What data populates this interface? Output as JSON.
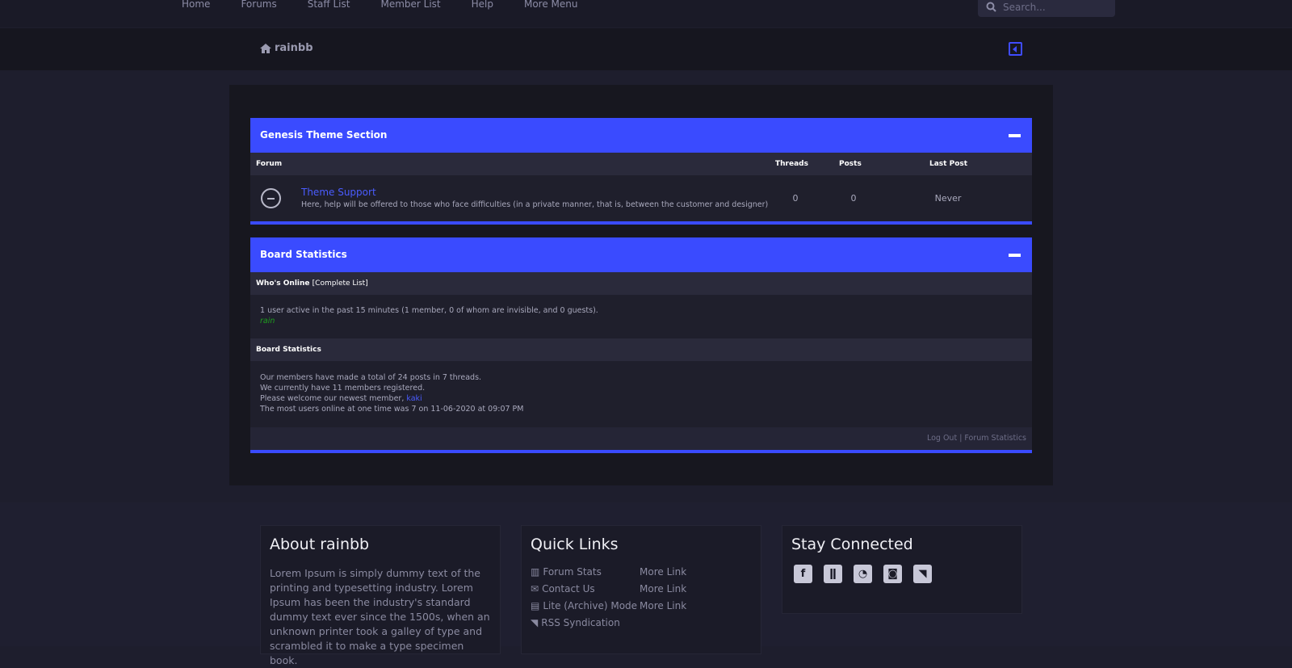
{
  "nav": {
    "items": [
      "Home",
      "Forums",
      "Staff List",
      "Member List",
      "Help",
      "More Menu"
    ],
    "search_placeholder": "Search..."
  },
  "breadcrumb": {
    "home": "rainbb"
  },
  "section1": {
    "title": "Genesis Theme Section",
    "columns": {
      "forum": "Forum",
      "threads": "Threads",
      "posts": "Posts",
      "last_post": "Last Post"
    },
    "forums": [
      {
        "title": "Theme Support",
        "description": "Here, help will be offered to those who face difficulties (in a private manner, that is, between the customer and designer)",
        "threads": "0",
        "posts": "0",
        "last_post": "Never"
      }
    ]
  },
  "section2": {
    "title": "Board Statistics",
    "whos_online": {
      "label": "Who's Online",
      "link": "[Complete List]",
      "text": "1 user active in the past 15 minutes (1 member, 0 of whom are invisible, and 0 guests).",
      "user": "rain"
    },
    "stats": {
      "label": "Board Statistics",
      "line1": "Our members have made a total of 24 posts in 7 threads.",
      "line2": "We currently have 11 members registered.",
      "line3": "Please welcome our newest member, ",
      "newest": "kaki",
      "line4": "The most users online at one time was 7 on 11-06-2020 at 09:07 PM"
    },
    "footer_links": "Log Out | Forum Statistics"
  },
  "footer": {
    "about": {
      "title": "About rainbb",
      "text": "Lorem Ipsum is simply dummy text of the printing and typesetting industry. Lorem Ipsum has been the industry's standard dummy text ever since the 1500s, when an unknown printer took a galley of type and scrambled it to make a type specimen book."
    },
    "quick": {
      "title": "Quick Links",
      "links": [
        "Forum Stats",
        "More Link",
        "Contact Us",
        "More Link",
        "Lite (Archive) Mode",
        "More Link",
        "RSS Syndication"
      ]
    },
    "social": {
      "title": "Stay Connected",
      "icons": [
        "facebook-icon",
        "twitch-icon",
        "steam-icon",
        "discord-icon",
        "rss-icon"
      ]
    }
  },
  "colors": {
    "accent": "#3a4bff",
    "online_user": "#1e9e1e"
  }
}
